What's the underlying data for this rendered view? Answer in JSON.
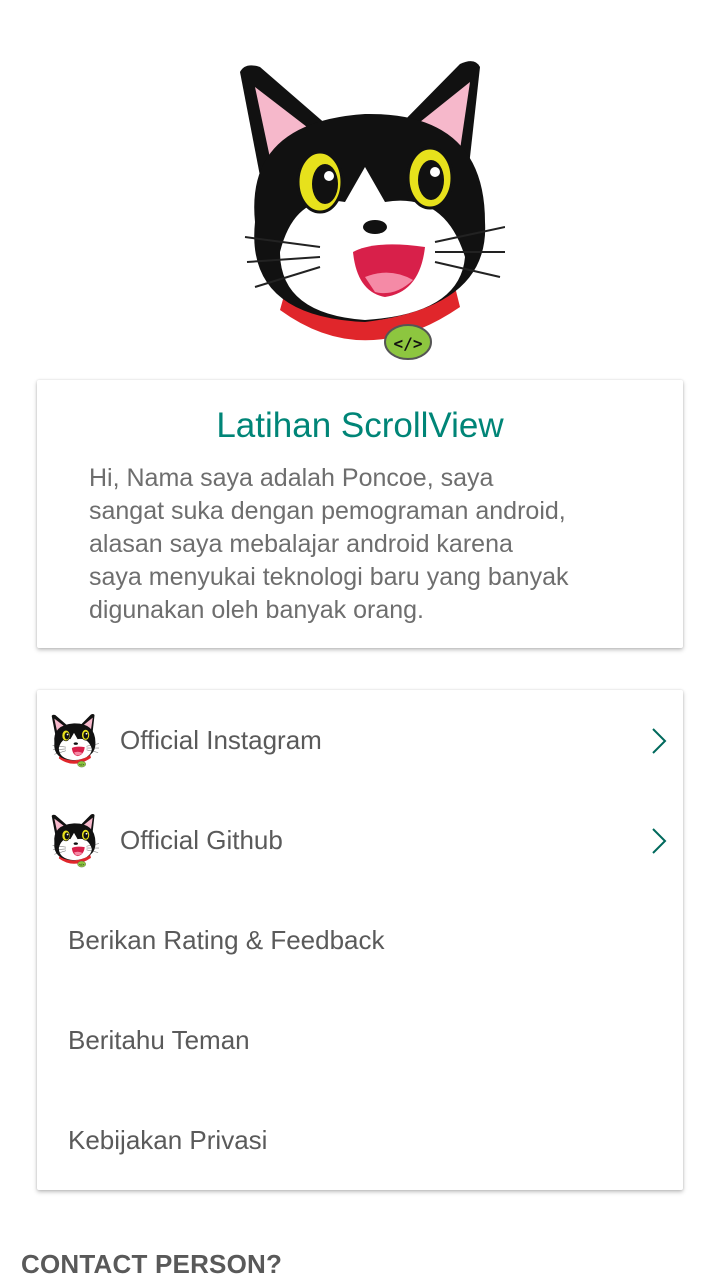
{
  "about": {
    "title": "Latihan ScrollView",
    "description": "Hi, Nama saya adalah Poncoe, saya\nsangat suka dengan pemograman android,\nalasan saya mebalajar android karena\nsaya menyukai teknologi baru yang banyak\ndigunakan oleh banyak orang."
  },
  "menu": {
    "instagram_label": "Official Instagram",
    "github_label": "Official Github",
    "rating_label": "Berikan Rating & Feedback",
    "share_label": "Beritahu Teman",
    "privacy_label": "Kebijakan Privasi"
  },
  "contact_heading": "CONTACT PERSON?",
  "colors": {
    "accent": "#008577",
    "text": "#5a5a5a",
    "collar": "#e0262b",
    "tag": "#8dc63f"
  },
  "icons": {
    "mascot": "cat-mascot-icon",
    "instagram": "cat-thumb-icon",
    "github": "cat-thumb-icon",
    "chevron": "chevron-right-icon"
  }
}
